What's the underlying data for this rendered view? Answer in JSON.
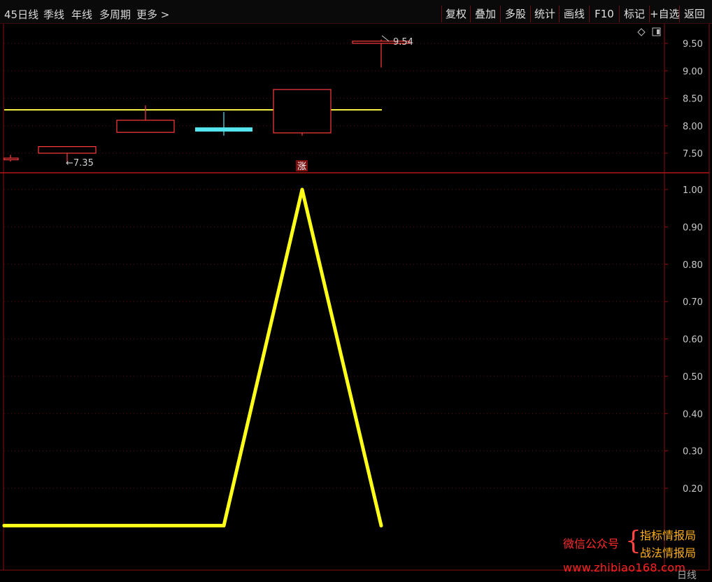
{
  "toolbar": {
    "periods": [
      "45日线",
      "季线",
      "年线",
      "多周期",
      "更多 >"
    ],
    "buttons": [
      "复权",
      "叠加",
      "多股",
      "统计",
      "画线",
      "F10",
      "标记",
      "+自选",
      "返回"
    ]
  },
  "chart_data": [
    {
      "type": "candlestick",
      "panel": "price",
      "ylim": [
        7.2,
        9.7
      ],
      "yticks": [
        "9.50",
        "9.00",
        "8.50",
        "8.00",
        "7.50"
      ],
      "candles": [
        {
          "open": 7.41,
          "close": 7.38,
          "high": 7.47,
          "low": 7.35
        },
        {
          "open": 7.5,
          "close": 7.62,
          "high": 7.62,
          "low": 7.35
        },
        {
          "open": 7.88,
          "close": 8.1,
          "high": 8.37,
          "low": 7.88
        },
        {
          "open": 7.93,
          "close": 7.97,
          "high": 8.25,
          "low": 7.82
        },
        {
          "open": 7.87,
          "close": 8.66,
          "high": 8.66,
          "low": 7.82
        },
        {
          "open": 9.54,
          "close": 9.5,
          "high": 9.57,
          "low": 9.06
        }
      ],
      "reference_line": 8.29,
      "annotations": [
        {
          "text": "←7.35",
          "value": 7.35
        },
        {
          "text": "9.54",
          "value": 9.54
        }
      ],
      "marker": {
        "text": "涨"
      },
      "colors": {
        "up": "#ff3b3b",
        "flat": "#55e6f0",
        "line": "#f0f040"
      }
    },
    {
      "type": "line",
      "panel": "indicator",
      "ylim": [
        0.02,
        1.05
      ],
      "yticks": [
        "1.00",
        "0.90",
        "0.80",
        "0.70",
        "0.60",
        "0.50",
        "0.40",
        "0.30",
        "0.20"
      ],
      "values": [
        0.1,
        0.1,
        0.1,
        0.1,
        1.0,
        0.1
      ],
      "colors": {
        "line": "#ffff1a"
      }
    }
  ],
  "watermark": {
    "left": "微信公众号",
    "brace": "{",
    "right_top": "指标情报局",
    "right_bottom": "战法情报局",
    "url": "www.zhibiao168.com"
  },
  "status": {
    "period_label": "日线"
  }
}
